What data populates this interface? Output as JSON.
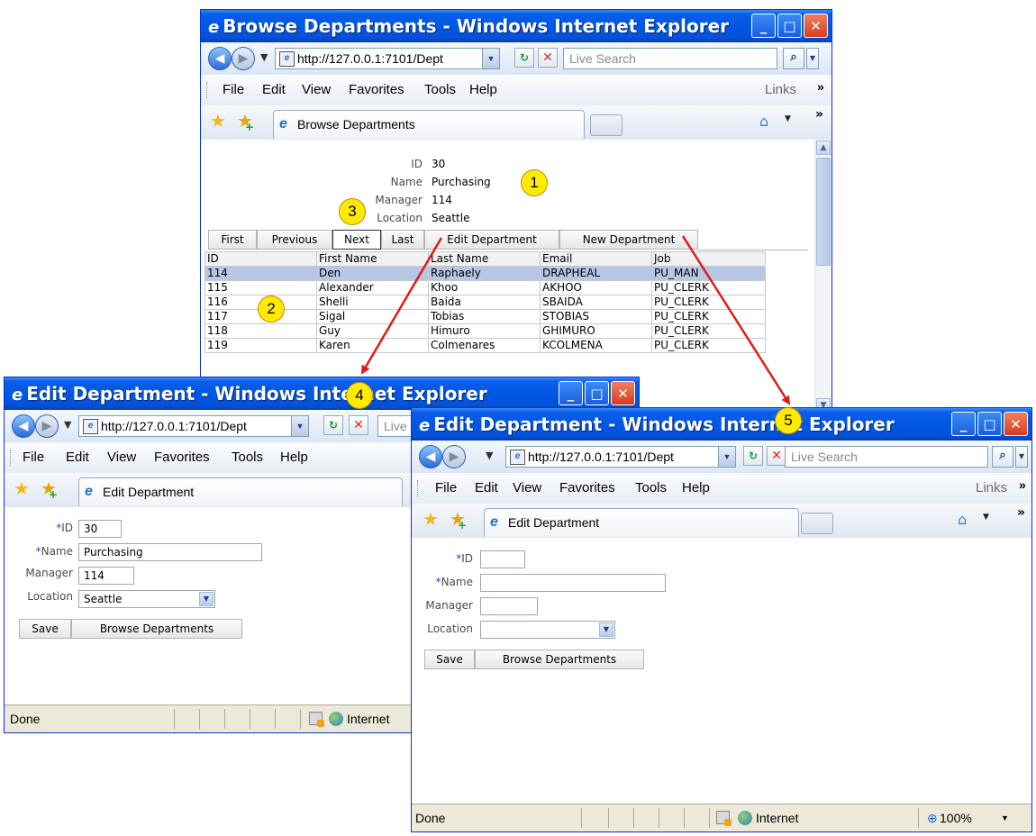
{
  "browse_window": {
    "title": "Browse Departments - Windows Internet Explorer",
    "url": "http://127.0.0.1:7101/Dept",
    "search_placeholder": "Live Search",
    "menu": [
      "File",
      "Edit",
      "View",
      "Favorites",
      "Tools",
      "Help"
    ],
    "links_label": "Links",
    "tab_label": "Browse Departments",
    "department": {
      "id_label": "ID",
      "id_value": "30",
      "name_label": "Name",
      "name_value": "Purchasing",
      "manager_label": "Manager",
      "manager_value": "114",
      "location_label": "Location",
      "location_value": "Seattle"
    },
    "buttons": {
      "first": "First",
      "previous": "Previous",
      "next": "Next",
      "last": "Last",
      "edit": "Edit Department",
      "new": "New Department"
    },
    "grid": {
      "columns": [
        "ID",
        "First Name",
        "Last Name",
        "Email",
        "Job"
      ],
      "rows": [
        [
          "114",
          "Den",
          "Raphaely",
          "DRAPHEAL",
          "PU_MAN"
        ],
        [
          "115",
          "Alexander",
          "Khoo",
          "AKHOO",
          "PU_CLERK"
        ],
        [
          "116",
          "Shelli",
          "Baida",
          "SBAIDA",
          "PU_CLERK"
        ],
        [
          "117",
          "Sigal",
          "Tobias",
          "STOBIAS",
          "PU_CLERK"
        ],
        [
          "118",
          "Guy",
          "Himuro",
          "GHIMURO",
          "PU_CLERK"
        ],
        [
          "119",
          "Karen",
          "Colmenares",
          "KCOLMENA",
          "PU_CLERK"
        ]
      ]
    }
  },
  "edit_window": {
    "title": "Edit Department - Windows Internet Explorer",
    "url": "http://127.0.0.1:7101/Dept",
    "search_placeholder": "Live",
    "menu": [
      "File",
      "Edit",
      "View",
      "Favorites",
      "Tools",
      "Help"
    ],
    "tab_label": "Edit Department",
    "form": {
      "id_label": "ID",
      "id_value": "30",
      "name_label": "Name",
      "name_value": "Purchasing",
      "manager_label": "Manager",
      "manager_value": "114",
      "location_label": "Location",
      "location_value": "Seattle",
      "required_mark": "*"
    },
    "save_label": "Save",
    "browse_label": "Browse Departments",
    "status_text": "Done",
    "zone_label": "Internet"
  },
  "new_window": {
    "title": "Edit Department - Windows Internet Explorer",
    "url": "http://127.0.0.1:7101/Dept",
    "search_placeholder": "Live Search",
    "menu": [
      "File",
      "Edit",
      "View",
      "Favorites",
      "Tools",
      "Help"
    ],
    "links_label": "Links",
    "tab_label": "Edit Department",
    "form": {
      "id_label": "ID",
      "id_value": "",
      "name_label": "Name",
      "name_value": "",
      "manager_label": "Manager",
      "manager_value": "",
      "location_label": "Location",
      "location_value": "",
      "required_mark": "*"
    },
    "save_label": "Save",
    "browse_label": "Browse Departments",
    "status_text": "Done",
    "zone_label": "Internet",
    "zoom_label": "100%"
  },
  "callouts": [
    "1",
    "2",
    "3",
    "4",
    "5"
  ],
  "colors": {
    "titlebar": "#0058e6",
    "selected_row": "#b6c6e6",
    "callout_fill": "#ffeb00",
    "arrow": "#e01b1b"
  },
  "icons": {
    "ie_logo": "ie-logo-icon",
    "back": "back-arrow-icon",
    "forward": "forward-arrow-icon",
    "refresh": "refresh-icon",
    "stop": "stop-icon",
    "search": "search-icon",
    "favorites": "favorites-star-icon",
    "add_favorites": "add-favorites-icon",
    "home": "home-icon",
    "zone": "internet-zone-icon"
  }
}
